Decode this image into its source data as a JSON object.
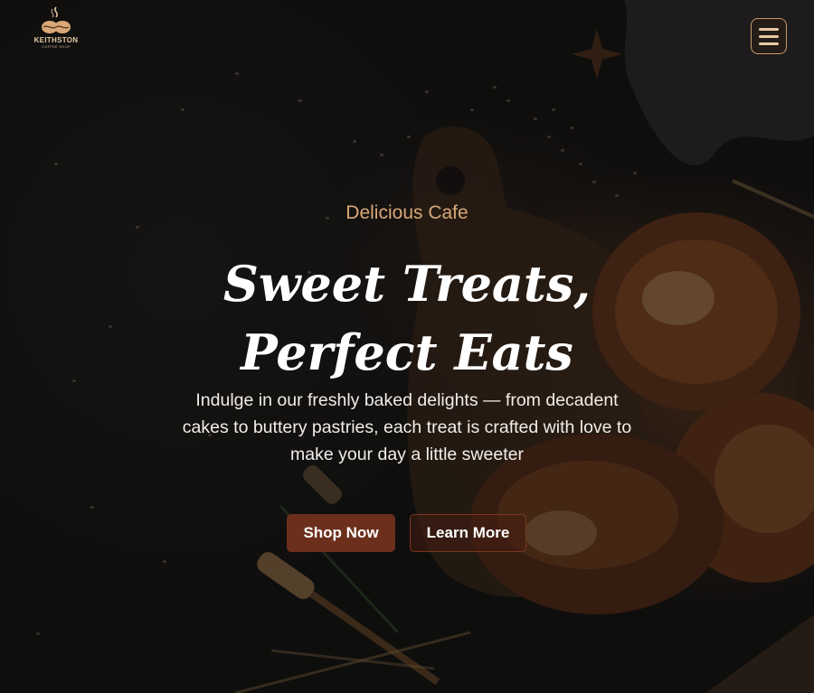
{
  "header": {
    "logo": {
      "name": "KEITHSTON",
      "subtitle": "COFFEE SHOP",
      "icon": "coffee-beans-icon"
    },
    "menu_button": {
      "icon": "hamburger-menu-icon"
    }
  },
  "hero": {
    "tagline": "Delicious Cafe",
    "headline_line1": "Sweet Treats,",
    "headline_line2": "Perfect Eats",
    "description": "Indulge in our freshly baked delights — from decadent cakes to buttery pastries, each treat is crafted with love to make your day a little sweeter",
    "buttons": {
      "shop_now": "Shop Now",
      "learn_more": "Learn More"
    }
  },
  "colors": {
    "accent": "#d9a877",
    "primary_button": "#6b2f1c",
    "menu_border": "#c79a6b",
    "background": "#141211"
  }
}
